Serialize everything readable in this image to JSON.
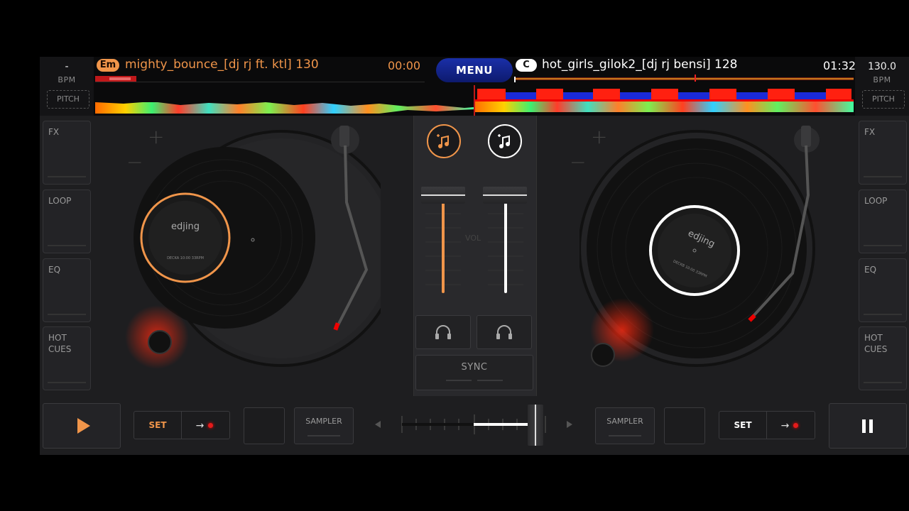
{
  "deck_a": {
    "bpm": "-",
    "bpm_label": "BPM",
    "pitch_label": "PITCH",
    "key": "Em",
    "title": "mighty_bounce_[dj rj ft. ktl] 130",
    "time": "00:00",
    "color": "#f0954a",
    "label_brand": "edjing",
    "label_small": "DECKA 10:00 33RPM"
  },
  "deck_b": {
    "bpm": "130.0",
    "bpm_label": "BPM",
    "pitch_label": "PITCH",
    "key": "C",
    "title": "hot_girls_gilok2_[dj rj bensi] 128",
    "time": "01:32",
    "color": "#ffffff",
    "label_brand": "edjing",
    "label_small": "DECKB 10:00 33RPM"
  },
  "menu_label": "MENU",
  "side_pads": [
    "FX",
    "LOOP",
    "EQ",
    "HOT\nCUES"
  ],
  "mixer": {
    "vol_label": "VOL",
    "sync_label": "SYNC",
    "fader_a_level": 0.92,
    "fader_b_level": 0.92
  },
  "bottom": {
    "set_label": "SET",
    "sampler_label": "SAMPLER",
    "crossfader_position": 0.93
  },
  "icons": {
    "play": "play-icon",
    "pause": "pause-icon",
    "headphones": "headphones-icon",
    "load": "music-note-plus-icon"
  }
}
